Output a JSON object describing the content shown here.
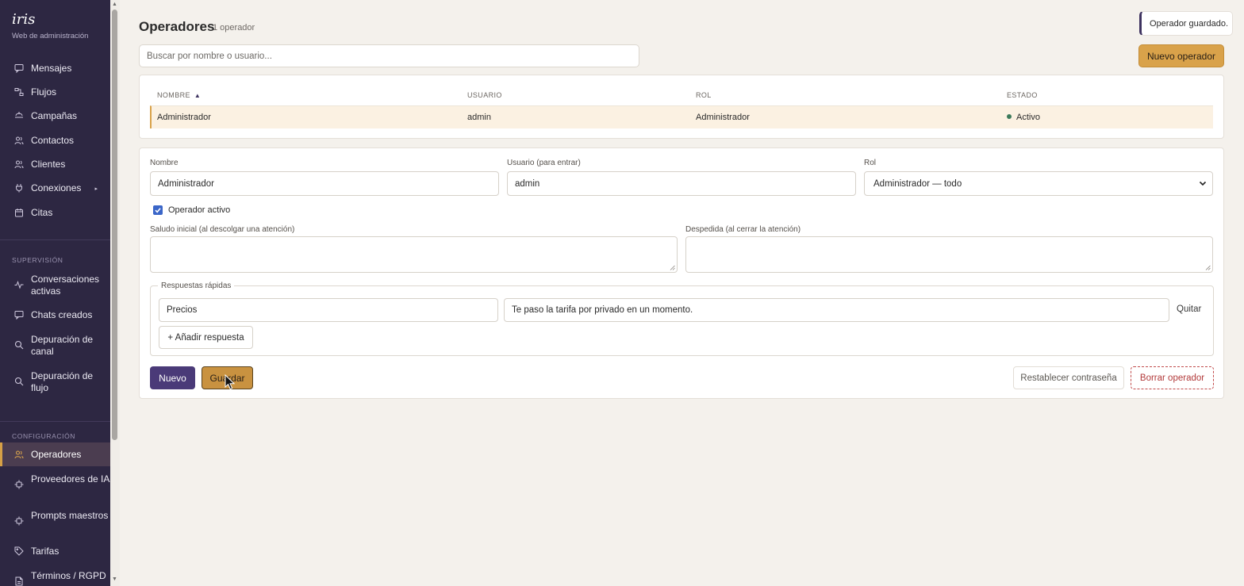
{
  "app": {
    "brand": "iris",
    "subtitle": "Web de administración"
  },
  "sidebar": {
    "items": [
      {
        "label": "Mensajes",
        "icon": "message-icon"
      },
      {
        "label": "Flujos",
        "icon": "flow-icon"
      },
      {
        "label": "Campañas",
        "icon": "campaign-icon"
      },
      {
        "label": "Contactos",
        "icon": "users-icon"
      },
      {
        "label": "Clientes",
        "icon": "users-icon"
      },
      {
        "label": "Conexiones",
        "icon": "plug-icon"
      },
      {
        "label": "Citas",
        "icon": "calendar-icon"
      }
    ],
    "supervision_label": "SUPERVISIÓN",
    "supervision_items": [
      {
        "label": "Conversaciones activas",
        "icon": "activity-icon"
      },
      {
        "label": "Chats creados",
        "icon": "message-icon"
      },
      {
        "label": "Depuración de canal",
        "icon": "search-icon"
      },
      {
        "label": "Depuración de flujo",
        "icon": "search-icon"
      }
    ],
    "config_label": "CONFIGURACIÓN",
    "config_items": [
      {
        "label": "Operadores",
        "icon": "users-icon",
        "active": true
      },
      {
        "label": "Proveedores de IA",
        "icon": "chip-icon"
      },
      {
        "label": "Prompts maestros",
        "icon": "chip-icon"
      },
      {
        "label": "Tarifas",
        "icon": "tag-icon"
      },
      {
        "label": "Términos / RGPD",
        "icon": "document-icon"
      }
    ]
  },
  "header": {
    "title": "Operadores",
    "count": "1 operador"
  },
  "toast": {
    "message": "Operador guardado."
  },
  "search": {
    "placeholder": "Buscar por nombre o usuario..."
  },
  "new_operator_button": "Nuevo operador",
  "table": {
    "columns": [
      "NOMBRE",
      "USUARIO",
      "ROL",
      "ESTADO"
    ],
    "sort_indicator": "▲",
    "rows": [
      {
        "nombre": "Administrador",
        "usuario": "admin",
        "rol": "Administrador",
        "estado": "Activo"
      }
    ]
  },
  "form": {
    "nombre_label": "Nombre",
    "nombre_value": "Administrador",
    "usuario_label": "Usuario (para entrar)",
    "usuario_value": "admin",
    "rol_label": "Rol",
    "rol_value": "Administrador — todo",
    "activo_label": "Operador activo",
    "activo_checked": true,
    "saludo_label": "Saludo inicial (al descolgar una atención)",
    "despedida_label": "Despedida (al cerrar la atención)",
    "quick_replies_label": "Respuestas rápidas",
    "quick_replies": [
      {
        "key": "Precios",
        "text": "Te paso la tarifa por privado en un momento.",
        "remove_label": "Quitar"
      }
    ],
    "add_reply_label": "+ Añadir respuesta",
    "nuevo_label": "Nuevo",
    "guardar_label": "Guardar",
    "reset_password_label": "Restablecer contraseña",
    "delete_label": "Borrar operador"
  },
  "colors": {
    "sidebar_bg": "#2d2742",
    "accent": "#d9a24a",
    "primary": "#4a3a78",
    "danger": "#b23a3a",
    "status_active": "#3b7a5a",
    "page_bg": "#f4f1ec"
  }
}
